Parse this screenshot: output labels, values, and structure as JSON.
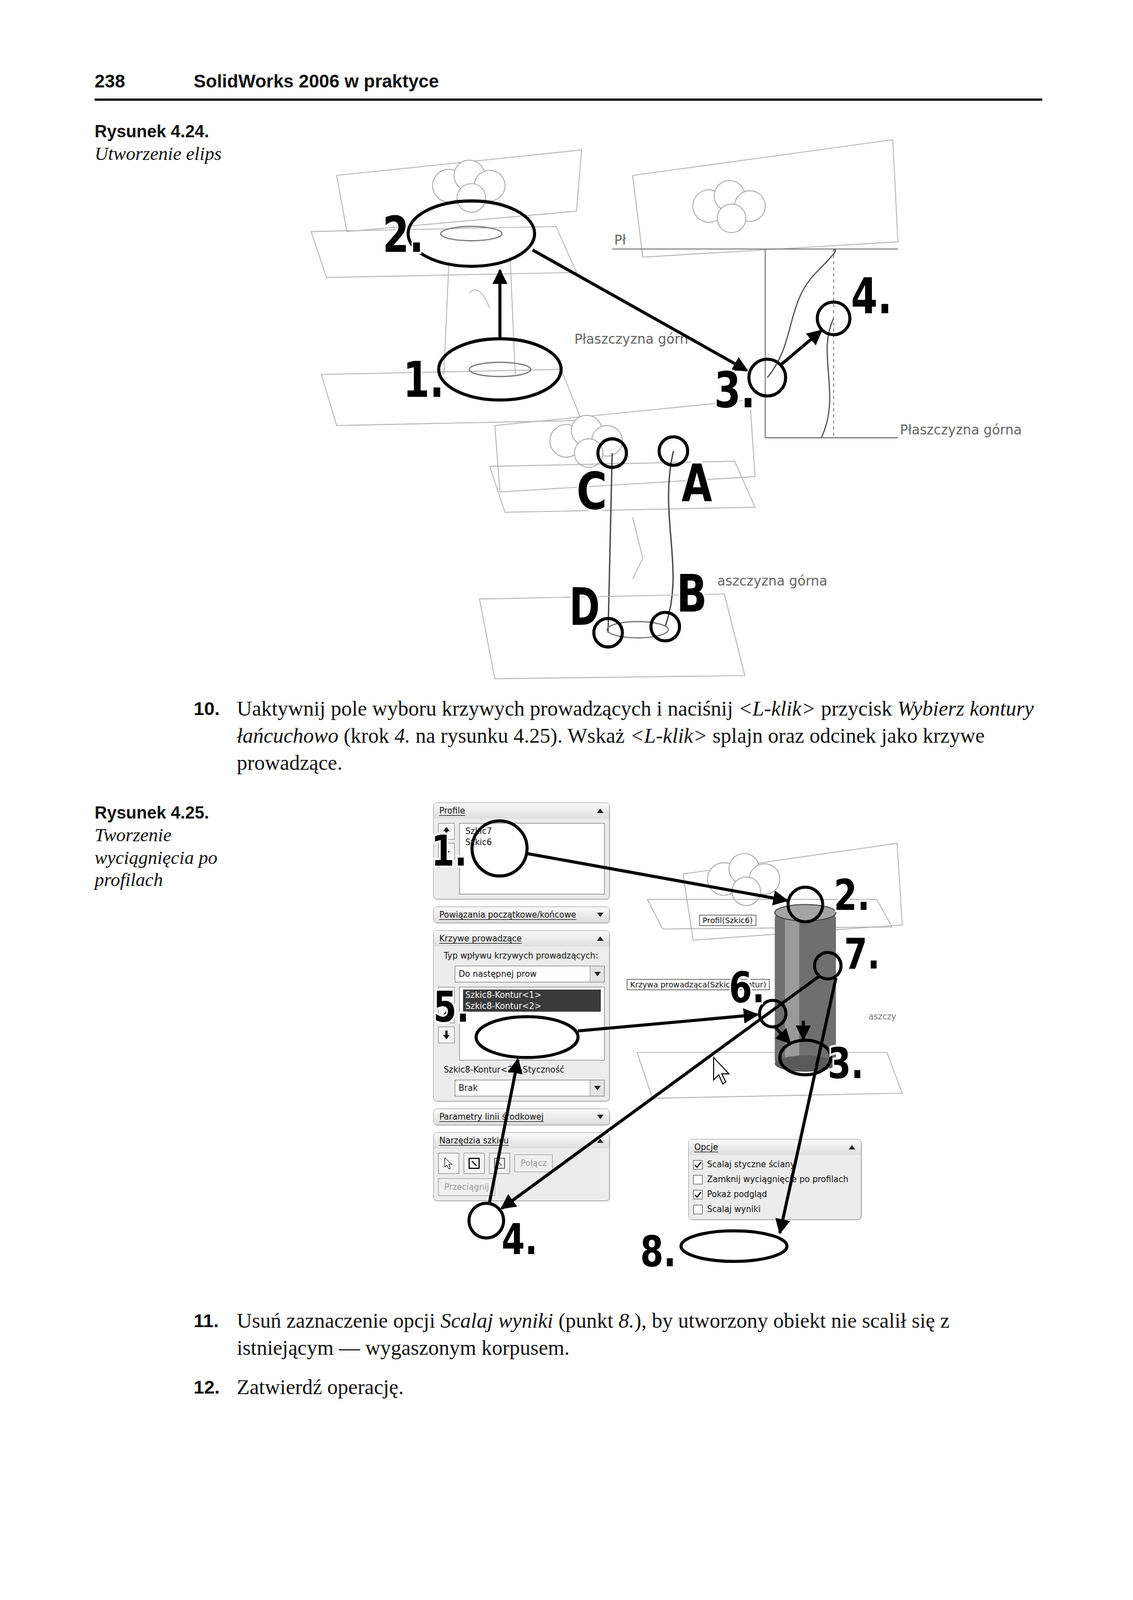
{
  "header": {
    "page_number": "238",
    "book_title": "SolidWorks 2006 w praktyce"
  },
  "figure_1": {
    "caption_number": "Rysunek 4.24.",
    "caption_text": "Utworzenie elips",
    "callouts": [
      "1.",
      "2.",
      "3.",
      "4."
    ],
    "points": [
      "A",
      "B",
      "C",
      "D"
    ],
    "plane_labels": [
      "Pł",
      "Płaszczyzna górn",
      "Płaszczyzna górna",
      "aszczyzna górna"
    ]
  },
  "steps_after_figure_1": [
    {
      "number": "10.",
      "segments": [
        {
          "text": "Uaktywnij pole wyboru krzywych prowadzących i naciśnij ",
          "italic": false
        },
        {
          "text": "<L-klik>",
          "italic": true
        },
        {
          "text": " przycisk ",
          "italic": false
        },
        {
          "text": "Wybierz kontury łańcuchowo",
          "italic": true
        },
        {
          "text": " (krok ",
          "italic": false
        },
        {
          "text": "4.",
          "italic": true
        },
        {
          "text": " na rysunku 4.25). Wskaż ",
          "italic": false
        },
        {
          "text": "<L-klik>",
          "italic": true
        },
        {
          "text": " splajn oraz odcinek jako krzywe prowadzące.",
          "italic": false
        }
      ]
    }
  ],
  "figure_2": {
    "caption_number": "Rysunek 4.25.",
    "caption_text": "Tworzenie wyciągnięcia po profilach",
    "callouts": [
      "1.",
      "2.",
      "3.",
      "4.",
      "5.",
      "6.",
      "7.",
      "8."
    ],
    "profiles_panel": {
      "title": "Profile",
      "items": [
        "Szkic7",
        "Szkic6"
      ]
    },
    "relations_panel": {
      "title": "Powiązania początkowe/końcowe"
    },
    "guides_panel": {
      "title": "Krzywe prowadzące",
      "influence_label": "Typ wpływu krzywych prowadzących:",
      "influence_value": "Do następnej prow",
      "items": [
        {
          "label": "Szkic8-Kontur<1>",
          "selected": true
        },
        {
          "label": "Szkic8-Kontur<2>",
          "selected": true
        }
      ],
      "tangency_label": "Szkic8-Kontur<2>-Styczność",
      "tangency_value": "Brak"
    },
    "centerline_panel": {
      "title": "Parametry linii środkowej"
    },
    "sketch_tools_panel": {
      "title": "Narzędzia szkicu",
      "buttons": [
        {
          "label": "Połącz",
          "disabled": true
        },
        {
          "label": "Przeciągnij",
          "disabled": true
        }
      ]
    },
    "viewport": {
      "profile_tag": "Profil(Szkic6)",
      "guide_tag": "Krzywa prowadząca(Szkic8-Kontur)",
      "plane_label": "aszczy"
    },
    "options_panel": {
      "title": "Opcje",
      "options": [
        {
          "label": "Scalaj styczne ściany",
          "checked": true
        },
        {
          "label": "Zamknij wyciągnięcie po profilach",
          "checked": false
        },
        {
          "label": "Pokaż podgląd",
          "checked": true
        },
        {
          "label": "Scalaj wyniki",
          "checked": false
        }
      ]
    }
  },
  "steps_after_figure_2": [
    {
      "number": "11.",
      "segments": [
        {
          "text": "Usuń zaznaczenie opcji ",
          "italic": false
        },
        {
          "text": "Scalaj wyniki",
          "italic": true
        },
        {
          "text": " (punkt ",
          "italic": false
        },
        {
          "text": "8.",
          "italic": true
        },
        {
          "text": "), by utworzony obiekt nie scalił się z istniejącym — wygaszonym korpusem.",
          "italic": false
        }
      ]
    },
    {
      "number": "12.",
      "segments": [
        {
          "text": "Zatwierdź operację.",
          "italic": false
        }
      ]
    }
  ]
}
